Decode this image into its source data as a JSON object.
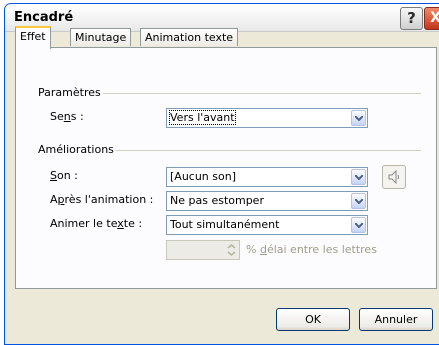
{
  "window": {
    "title": "Encadré"
  },
  "titlebar": {
    "help_label": "?",
    "close_label": "X"
  },
  "tabs": [
    {
      "label": "Effet"
    },
    {
      "label": "Minutage"
    },
    {
      "label": "Animation texte"
    }
  ],
  "parametres": {
    "label": "Paramètres",
    "sens": {
      "label_pre": "Se",
      "label_acc": "n",
      "label_post": "s :",
      "value": "Vers l'avant"
    }
  },
  "ameliorations": {
    "label": "Améliorations",
    "son": {
      "label_acc": "S",
      "label_post": "on :",
      "value": "[Aucun son]"
    },
    "apres": {
      "label_pre": "A",
      "label_acc": "p",
      "label_post": "rès l'animation :",
      "value": "Ne pas estomper"
    },
    "animer": {
      "label_pre": "Animer le te",
      "label_acc": "x",
      "label_post": "te :",
      "value": "Tout simultanément"
    },
    "delai": {
      "value": "",
      "hint_pre": "% ",
      "hint_acc": "d",
      "hint_post": "élai entre les lettres"
    }
  },
  "buttons": {
    "ok": "OK",
    "cancel": "Annuler"
  }
}
